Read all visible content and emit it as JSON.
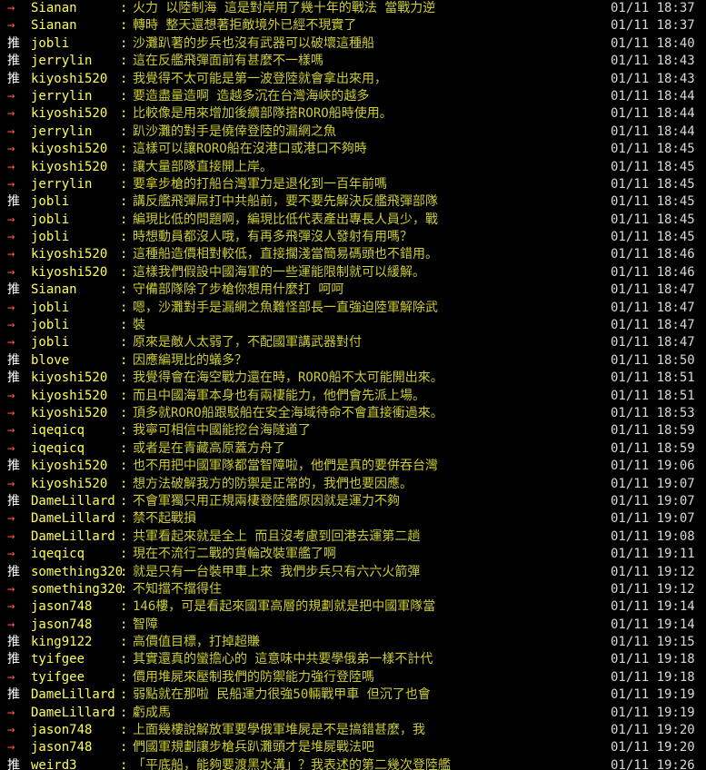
{
  "colors": {
    "background": "#000000",
    "push": "#ffffff",
    "arrow": "#ff4d4d",
    "user": "#ffff55",
    "message": "#cccc33",
    "time": "#d8d8d8"
  },
  "comments": [
    {
      "tag": "→",
      "user": "Sianan",
      "msg": "火力 以陸制海 這是對岸用了幾十年的戰法 當戰力逆",
      "time": "01/11 18:37"
    },
    {
      "tag": "→",
      "user": "Sianan",
      "msg": "轉時 整天還想著拒敵境外已經不現實了",
      "time": "01/11 18:37"
    },
    {
      "tag": "推",
      "user": "jobli",
      "msg": "沙灘趴著的步兵也沒有武器可以破壞這種船",
      "time": "01/11 18:40"
    },
    {
      "tag": "推",
      "user": "jerrylin",
      "msg": "這在反艦飛彈面前有甚麼不一樣嗎",
      "time": "01/11 18:43"
    },
    {
      "tag": "推",
      "user": "kiyoshi520",
      "msg": "我覺得不太可能是第一波登陸就會拿出來用，",
      "time": "01/11 18:43"
    },
    {
      "tag": "→",
      "user": "jerrylin",
      "msg": "要造盡量造啊  造越多沉在台灣海峽的越多",
      "time": "01/11 18:44"
    },
    {
      "tag": "→",
      "user": "kiyoshi520",
      "msg": "比較像是用來增加後續部隊搭RORO船時使用。",
      "time": "01/11 18:44"
    },
    {
      "tag": "→",
      "user": "jerrylin",
      "msg": "趴沙灘的對手是僥倖登陸的漏網之魚",
      "time": "01/11 18:44"
    },
    {
      "tag": "→",
      "user": "kiyoshi520",
      "msg": "這樣可以讓RORO船在沒港口或港口不夠時",
      "time": "01/11 18:45"
    },
    {
      "tag": "→",
      "user": "kiyoshi520",
      "msg": "讓大量部隊直接開上岸。",
      "time": "01/11 18:45"
    },
    {
      "tag": "→",
      "user": "jerrylin",
      "msg": "要拿步槍的打船台灣軍力是退化到一百年前嗎",
      "time": "01/11 18:45"
    },
    {
      "tag": "推",
      "user": "jobli",
      "msg": "講反艦飛彈屌打中共船前，要不要先解決反艦飛彈部隊",
      "time": "01/11 18:45"
    },
    {
      "tag": "→",
      "user": "jobli",
      "msg": "編現比低的問題啊，編現比低代表產出專長人員少，戰",
      "time": "01/11 18:45"
    },
    {
      "tag": "→",
      "user": "jobli",
      "msg": "時想動員都沒人哦，有再多飛彈沒人發射有用嗎？",
      "time": "01/11 18:45"
    },
    {
      "tag": "→",
      "user": "kiyoshi520",
      "msg": "這種船造價相對較低，直接擱淺當簡易碼頭也不錯用。",
      "time": "01/11 18:46"
    },
    {
      "tag": "→",
      "user": "kiyoshi520",
      "msg": "這樣我們假設中國海軍的一些運能限制就可以緩解。",
      "time": "01/11 18:46"
    },
    {
      "tag": "推",
      "user": "Sianan",
      "msg": "守備部隊除了步槍你想用什麼打 呵呵",
      "time": "01/11 18:47"
    },
    {
      "tag": "→",
      "user": "jobli",
      "msg": "嗯，沙灘對手是漏網之魚難怪部長一直強迫陸軍解除武",
      "time": "01/11 18:47"
    },
    {
      "tag": "→",
      "user": "jobli",
      "msg": "裝",
      "time": "01/11 18:47"
    },
    {
      "tag": "→",
      "user": "jobli",
      "msg": "原來是敵人太弱了，不配國軍講武器對付",
      "time": "01/11 18:47"
    },
    {
      "tag": "推",
      "user": "blove",
      "msg": "因應編現比的蟻多？",
      "time": "01/11 18:50"
    },
    {
      "tag": "推",
      "user": "kiyoshi520",
      "msg": "我覺得會在海空戰力還在時，RORO船不太可能開出來。",
      "time": "01/11 18:51"
    },
    {
      "tag": "→",
      "user": "kiyoshi520",
      "msg": "而且中國海軍本身也有兩棲能力，他們會先派上場。",
      "time": "01/11 18:51"
    },
    {
      "tag": "→",
      "user": "kiyoshi520",
      "msg": "頂多就RORO船跟駁船在安全海域待命不會直接衝過來。",
      "time": "01/11 18:53"
    },
    {
      "tag": "→",
      "user": "iqeqicq",
      "msg": "我寧可相信中國能挖台海隧道了",
      "time": "01/11 18:59"
    },
    {
      "tag": "→",
      "user": "iqeqicq",
      "msg": "或者是在青藏高原蓋方舟了",
      "time": "01/11 18:59"
    },
    {
      "tag": "推",
      "user": "kiyoshi520",
      "msg": "也不用把中國軍隊都當智障啦，他們是真的要併吞台灣",
      "time": "01/11 19:06"
    },
    {
      "tag": "→",
      "user": "kiyoshi520",
      "msg": "想方法破解我方的防禦是正常的，我們也要因應。",
      "time": "01/11 19:07"
    },
    {
      "tag": "推",
      "user": "DameLillard",
      "msg": "不會軍獨只用正規兩棲登陸艦原因就是運力不夠",
      "time": "01/11 19:07"
    },
    {
      "tag": "→",
      "user": "DameLillard",
      "msg": "禁不起戰損",
      "time": "01/11 19:07"
    },
    {
      "tag": "→",
      "user": "DameLillard",
      "msg": "共軍看起來就是全上 而且沒考慮到回港去運第二趟",
      "time": "01/11 19:08"
    },
    {
      "tag": "→",
      "user": "iqeqicq",
      "msg": "現在不流行二戰的貨輪改裝軍艦了啊",
      "time": "01/11 19:11"
    },
    {
      "tag": "推",
      "user": "something320",
      "msg": "就是只有一台裝甲車上來 我們步兵只有六六火箭彈",
      "time": "01/11 19:12"
    },
    {
      "tag": "→",
      "user": "something320",
      "msg": "不知擋不擋得住",
      "time": "01/11 19:12"
    },
    {
      "tag": "→",
      "user": "jason748",
      "msg": "146樓，可是看起來國軍高層的規劃就是把中國軍隊當",
      "time": "01/11 19:14"
    },
    {
      "tag": "→",
      "user": "jason748",
      "msg": "智障",
      "time": "01/11 19:14"
    },
    {
      "tag": "推",
      "user": "king9122",
      "msg": "高價值目標，打掉超賺",
      "time": "01/11 19:15"
    },
    {
      "tag": "推",
      "user": "tyifgee",
      "msg": "其實還真的蠻擔心的 這意味中共要學俄弟一樣不計代",
      "time": "01/11 19:18"
    },
    {
      "tag": "→",
      "user": "tyifgee",
      "msg": "價用堆屍來壓制我們的防禦能力強行登陸嗎",
      "time": "01/11 19:18"
    },
    {
      "tag": "推",
      "user": "DameLillard",
      "msg": "弱點就在那啦 民船運力很強50輛戰甲車 但沉了也會",
      "time": "01/11 19:19"
    },
    {
      "tag": "→",
      "user": "DameLillard",
      "msg": "虧成馬",
      "time": "01/11 19:19"
    },
    {
      "tag": "→",
      "user": "jason748",
      "msg": "上面幾樓說解放軍要學俄軍堆屍是不是搞錯甚麼，我",
      "time": "01/11 19:20"
    },
    {
      "tag": "→",
      "user": "jason748",
      "msg": "們國軍規劃讓步槍兵趴灘頭才是堆屍戰法吧",
      "time": "01/11 19:20"
    },
    {
      "tag": "推",
      "user": "weird3",
      "msg": "「平底船，能夠要渡黑水溝」？我表述的第二幾次登陸艦",
      "time": "01/11 19:26"
    }
  ]
}
